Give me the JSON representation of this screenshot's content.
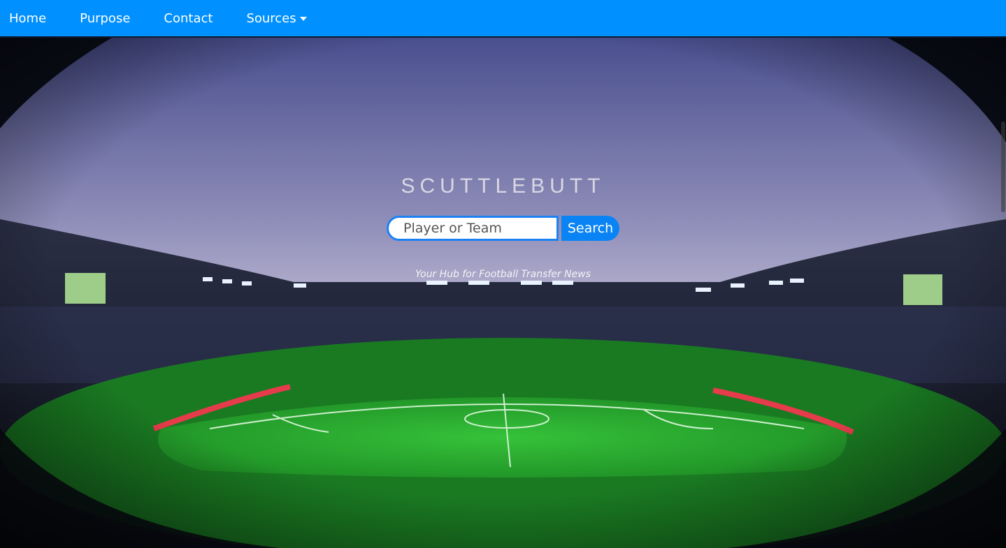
{
  "nav": {
    "home": "Home",
    "purpose": "Purpose",
    "contact": "Contact",
    "sources": "Sources"
  },
  "hero": {
    "title": "SCUTTLEBUTT",
    "search_placeholder": "Player or Team",
    "search_button": "Search",
    "tagline": "Your Hub for Football Transfer News"
  },
  "colors": {
    "nav_bg": "#0090ff",
    "accent": "#0a84f5"
  }
}
